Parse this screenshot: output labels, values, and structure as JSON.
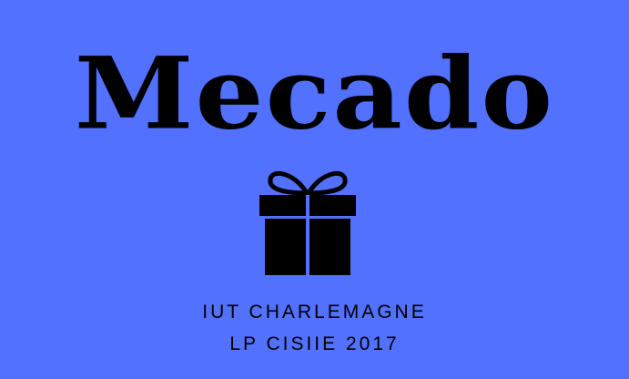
{
  "logo": {
    "title": "Mecado",
    "icon": "gift-icon",
    "line1": "IUT CHARLEMAGNE",
    "line2": "LP CISIIE 2017"
  },
  "colors": {
    "background": "#5271ff",
    "foreground": "#000000"
  }
}
